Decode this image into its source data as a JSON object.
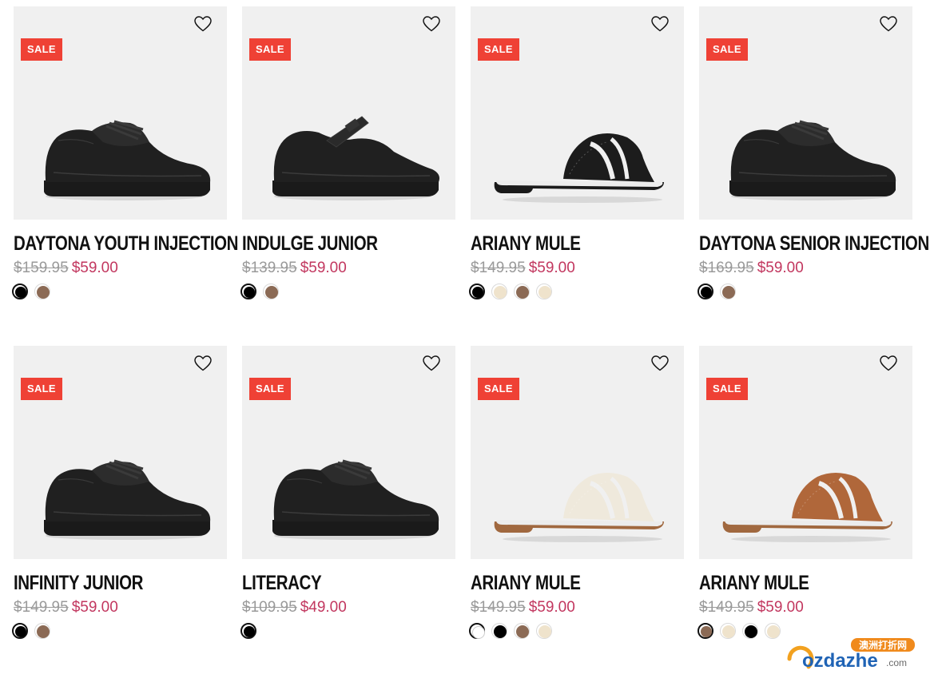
{
  "products": [
    {
      "title": "DAYTONA YOUTH INJECTION",
      "badge": "SALE",
      "old_price": "$159.95",
      "new_price": "$59.00",
      "shoe_style": "lace-up",
      "swatches": [
        "#000000",
        "#8b6a55"
      ],
      "selected_swatch": 0
    },
    {
      "title": "INDULGE JUNIOR",
      "badge": "SALE",
      "old_price": "$139.95",
      "new_price": "$59.00",
      "shoe_style": "mary-jane",
      "swatches": [
        "#000000",
        "#8b6a55"
      ],
      "selected_swatch": 0
    },
    {
      "title": "ARIANY MULE",
      "badge": "SALE",
      "old_price": "$149.95",
      "new_price": "$59.00",
      "shoe_style": "mule",
      "shoe_color": "#1c1c1c",
      "sole_color": "#1a1a1a",
      "swatches": [
        "#000000",
        "#efe3cc",
        "#8b6a55",
        "#efe3cc"
      ],
      "selected_swatch": 0
    },
    {
      "title": "DAYTONA SENIOR INJECTION",
      "badge": "SALE",
      "old_price": "$169.95",
      "new_price": "$59.00",
      "shoe_style": "lace-up",
      "swatches": [
        "#000000",
        "#8b6a55"
      ],
      "selected_swatch": 0
    },
    {
      "title": "INFINITY JUNIOR",
      "badge": "SALE",
      "old_price": "$149.95",
      "new_price": "$59.00",
      "shoe_style": "lace-up",
      "swatches": [
        "#000000",
        "#8b6a55"
      ],
      "selected_swatch": 0
    },
    {
      "title": "LITERACY",
      "badge": "SALE",
      "old_price": "$109.95",
      "new_price": "$49.00",
      "shoe_style": "lace-up",
      "swatches": [
        "#000000"
      ],
      "selected_swatch": 0
    },
    {
      "title": "ARIANY MULE",
      "badge": "SALE",
      "old_price": "$149.95",
      "new_price": "$59.00",
      "shoe_style": "mule",
      "shoe_color": "#efe9dc",
      "sole_color": "#a0683f",
      "swatches": [
        "#ffffff",
        "#000000",
        "#8b6a55",
        "#efe3cc"
      ],
      "selected_swatch": 0
    },
    {
      "title": "ARIANY MULE",
      "badge": "SALE",
      "old_price": "$149.95",
      "new_price": "$59.00",
      "shoe_style": "mule",
      "shoe_color": "#b0673a",
      "sole_color": "#a0683f",
      "swatches": [
        "#8b6a55",
        "#efe3cc",
        "#000000",
        "#efe3cc"
      ],
      "selected_swatch": 0
    }
  ],
  "wishlist_icon": "heart-outline-icon",
  "watermark": {
    "text_top": "澳洲打折网",
    "text_main": "ozdazhe",
    "text_suffix": ".com"
  },
  "colors": {
    "sale_badge": "#ef4135",
    "sale_price": "#c2375f",
    "old_price": "#9a9a9a",
    "image_bg": "#f0f0f0"
  }
}
